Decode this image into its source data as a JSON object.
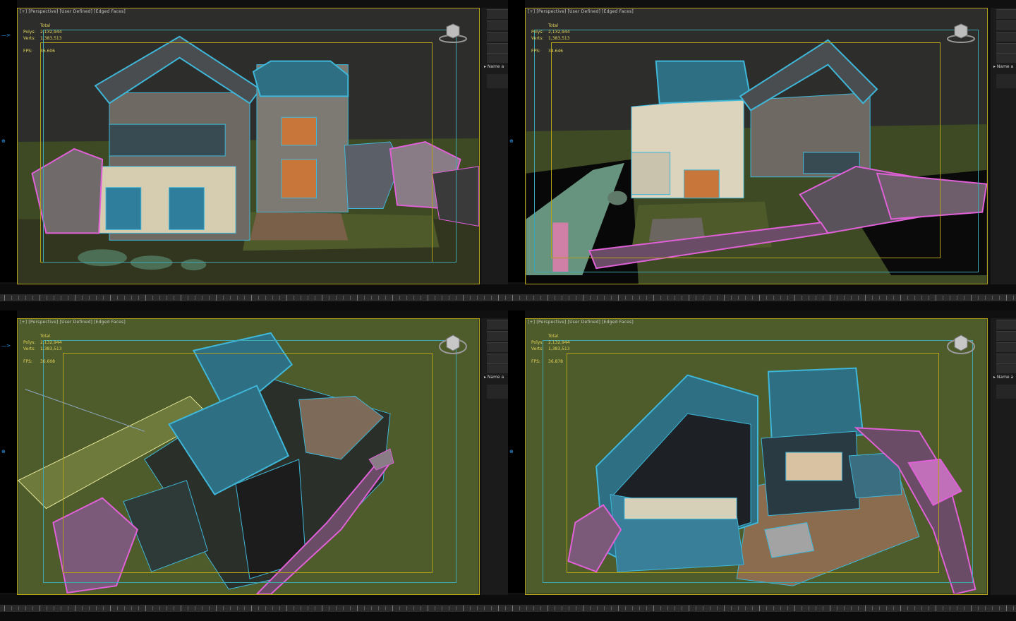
{
  "viewports": [
    {
      "id": "top-left",
      "label": "[+] [Perspective] [User Defined] [Edged Faces]",
      "stats": {
        "header": "Total",
        "polys_label": "Polys:",
        "polys": "2,132,944",
        "verts_label": "Verts:",
        "verts": "1,383,513",
        "fps_label": "FPS:",
        "fps": "36.606"
      },
      "panel_label": "Name a"
    },
    {
      "id": "top-right",
      "label": "[+] [Perspective] [User Defined] [Edged Faces]",
      "stats": {
        "header": "Total",
        "polys_label": "Polys:",
        "polys": "2,132,944",
        "verts_label": "Verts:",
        "verts": "1,383,513",
        "fps_label": "FPS:",
        "fps": "34.646"
      },
      "panel_label": "Name a"
    },
    {
      "id": "bottom-left",
      "label": "[+] [Perspective] [User Defined] [Edged Faces]",
      "stats": {
        "header": "Total",
        "polys_label": "Polys:",
        "polys": "2,132,944",
        "verts_label": "Verts:",
        "verts": "1,383,513",
        "fps_label": "FPS:",
        "fps": "36.608"
      },
      "panel_label": "Name a"
    },
    {
      "id": "bottom-right",
      "label": "[+] [Perspective] [User Defined] [Edged Faces]",
      "stats": {
        "header": "Total",
        "polys_label": "Polys:",
        "polys": "2,132,944",
        "verts_label": "Verts:",
        "verts": "1,383,513",
        "fps_label": "FPS:",
        "fps": "36.878"
      },
      "panel_label": "Name a"
    }
  ],
  "colors": {
    "roof_wire": "#3fb7d9",
    "wall_wire": "#e060d8",
    "ground": "#4e5b2a",
    "frame": "#b3a11c",
    "safe_frame": "#3fa7b2",
    "stats_text": "#e2d35a"
  },
  "icons": [
    "viewcube-icon",
    "axis-gizmo-icon"
  ]
}
